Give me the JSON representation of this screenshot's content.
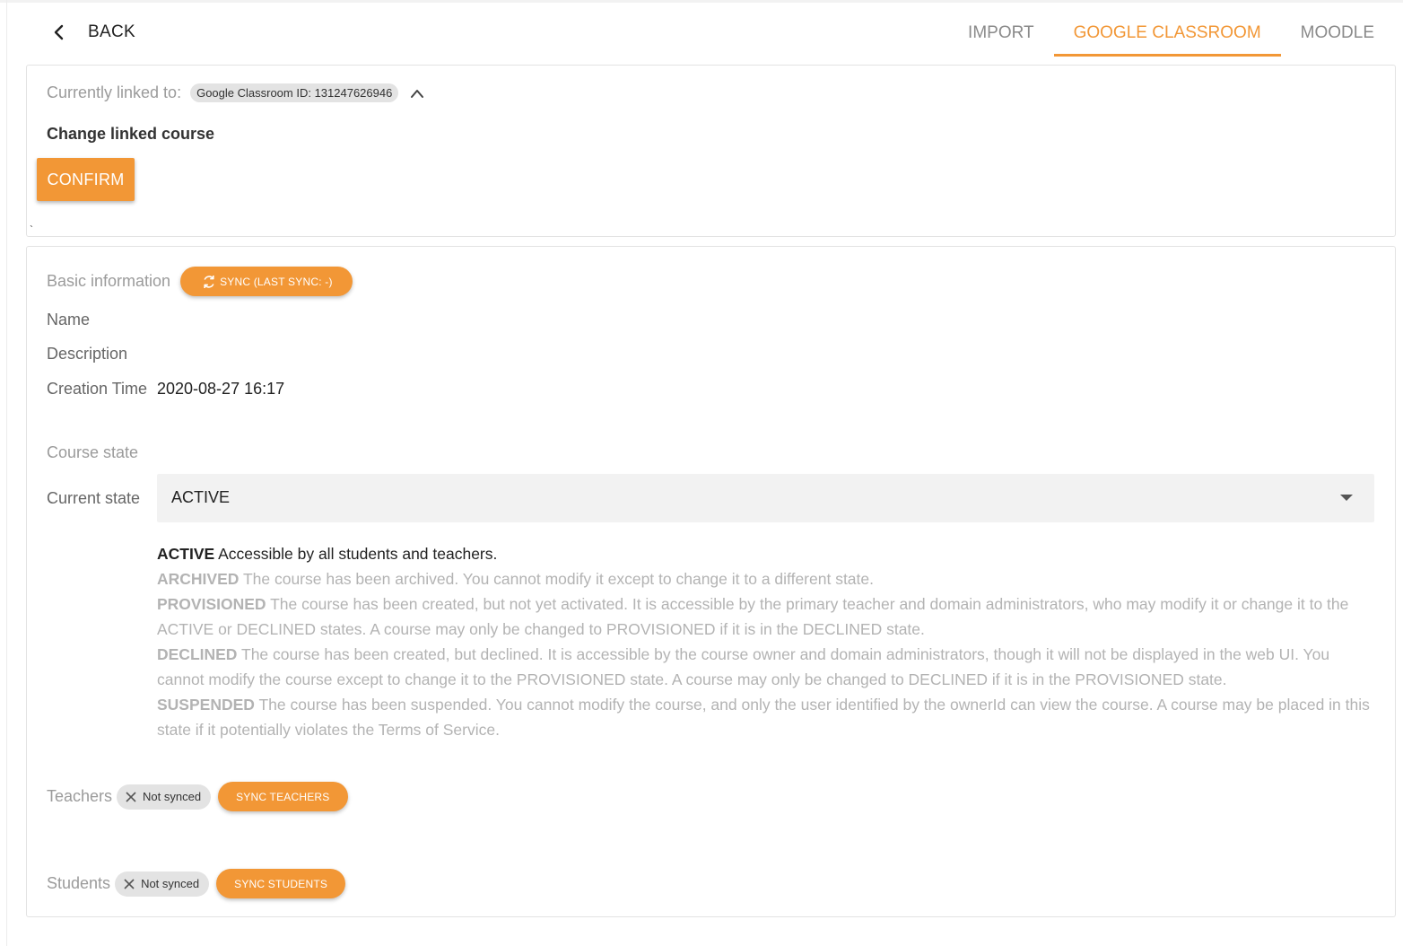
{
  "header": {
    "back_label": "BACK",
    "tabs": [
      {
        "label": "IMPORT",
        "active": false
      },
      {
        "label": "GOOGLE CLASSROOM",
        "active": true
      },
      {
        "label": "MOODLE",
        "active": false
      }
    ]
  },
  "link_panel": {
    "currently_linked_label": "Currently linked to:",
    "linked_chip": "Google Classroom ID: 131247626946",
    "change_title": "Change linked course",
    "confirm_label": "CONFIRM",
    "tick": "`"
  },
  "info_panel": {
    "basic_info_label": "Basic information",
    "sync_label": "SYNC (LAST SYNC: -)",
    "name_label": "Name",
    "description_label": "Description",
    "creation_time_label": "Creation Time",
    "creation_time_value": "2020-08-27 16:17",
    "course_state_label": "Course state",
    "current_state_label": "Current state",
    "current_state_value": "ACTIVE",
    "states": [
      {
        "name": "ACTIVE",
        "text": "Accessible by all students and teachers."
      },
      {
        "name": "ARCHIVED",
        "text": "The course has been archived. You cannot modify it except to change it to a different state."
      },
      {
        "name": "PROVISIONED",
        "text": "The course has been created, but not yet activated. It is accessible by the primary teacher and domain administrators, who may modify it or change it to the ACTIVE or DECLINED states. A course may only be changed to PROVISIONED if it is in the DECLINED state."
      },
      {
        "name": "DECLINED",
        "text": "The course has been created, but declined. It is accessible by the course owner and domain administrators, though it will not be displayed in the web UI. You cannot modify the course except to change it to the PROVISIONED state. A course may only be changed to DECLINED if it is in the PROVISIONED state."
      },
      {
        "name": "SUSPENDED",
        "text": "The course has been suspended. You cannot modify the course, and only the user identified by the ownerId can view the course. A course may be placed in this state if it potentially violates the Terms of Service."
      }
    ],
    "teachers_label": "Teachers",
    "teachers_status": "Not synced",
    "sync_teachers_label": "SYNC TEACHERS",
    "students_label": "Students",
    "students_status": "Not synced",
    "sync_students_label": "SYNC STUDENTS"
  },
  "colors": {
    "accent": "#f29736",
    "chip_bg": "#e3e3e3",
    "muted_text": "#b3b3b3"
  }
}
